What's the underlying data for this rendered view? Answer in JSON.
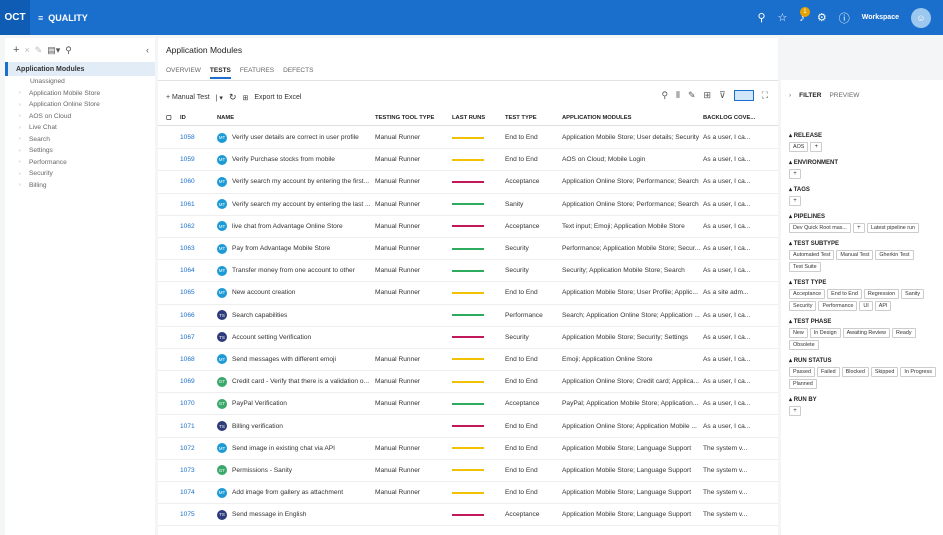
{
  "topbar": {
    "logo": "OCT",
    "menu_icon": "≡",
    "title": "QUALITY",
    "workspace": "Workspace",
    "notification_count": "1"
  },
  "left": {
    "root": "Application Modules",
    "items": [
      {
        "label": "Unassigned",
        "arrow": ""
      },
      {
        "label": "Application Mobile Store",
        "arrow": "›"
      },
      {
        "label": "Application Online Store",
        "arrow": "›"
      },
      {
        "label": "AOS on Cloud",
        "arrow": "›"
      },
      {
        "label": "Live Chat",
        "arrow": "›"
      },
      {
        "label": "Search",
        "arrow": "›"
      },
      {
        "label": "Settings",
        "arrow": "›"
      },
      {
        "label": "Performance",
        "arrow": "›"
      },
      {
        "label": "Security",
        "arrow": "›"
      },
      {
        "label": "Billing",
        "arrow": "›"
      }
    ]
  },
  "main": {
    "title": "Application Modules",
    "tabs": [
      "OVERVIEW",
      "TESTS",
      "FEATURES",
      "DEFECTS"
    ],
    "toolbar": {
      "manual_test": "+ Manual Test",
      "export": "Export to Excel"
    },
    "columns": {
      "id": "ID",
      "name": "NAME",
      "tool": "TESTING TOOL TYPE",
      "last_runs": "LAST RUNS",
      "type": "TEST TYPE",
      "modules": "APPLICATION MODULES",
      "backlog": "BACKLOG COVE..."
    },
    "rows": [
      {
        "id": "1058",
        "icon": "MT",
        "ic_color": "#1b9ad6",
        "name": "Verify user details are correct in user profile",
        "tool": "Manual Runner",
        "lr": "#f2c200",
        "type": "End to End",
        "mod": "Application Mobile Store; User details; Security",
        "back": "As a user, I ca..."
      },
      {
        "id": "1059",
        "icon": "MT",
        "ic_color": "#1b9ad6",
        "name": "Verify Purchase stocks from mobile",
        "tool": "Manual Runner",
        "lr": "#f2c200",
        "type": "End to End",
        "mod": "AOS on Cloud; Mobile Login",
        "back": "As a user, I ca..."
      },
      {
        "id": "1060",
        "icon": "MT",
        "ic_color": "#1b9ad6",
        "name": "Verify search my account by entering the first...",
        "tool": "Manual Runner",
        "lr": "#c2185b",
        "type": "Acceptance",
        "mod": "Application Online Store; Performance; Search",
        "back": "As a user, I ca..."
      },
      {
        "id": "1061",
        "icon": "MT",
        "ic_color": "#1b9ad6",
        "name": "Verify search my account by entering the last ...",
        "tool": "Manual Runner",
        "lr": "#2eaa5e",
        "type": "Sanity",
        "mod": "Application Online Store; Performance; Search",
        "back": "As a user, I ca..."
      },
      {
        "id": "1062",
        "icon": "MT",
        "ic_color": "#1b9ad6",
        "name": "live chat from Advantage Online Store",
        "tool": "Manual Runner",
        "lr": "#c2185b",
        "type": "Acceptance",
        "mod": "Text input; Emoji; Application Mobile Store",
        "back": "As a user, I ca..."
      },
      {
        "id": "1063",
        "icon": "MT",
        "ic_color": "#1b9ad6",
        "name": "Pay from Advantage Mobile Store",
        "tool": "Manual Runner",
        "lr": "#2eaa5e",
        "type": "Security",
        "mod": "Performance; Application Mobile Store; Secur...",
        "back": "As a user, I ca..."
      },
      {
        "id": "1064",
        "icon": "MT",
        "ic_color": "#1b9ad6",
        "name": "Transfer money from one account to other",
        "tool": "Manual Runner",
        "lr": "#2eaa5e",
        "type": "Security",
        "mod": "Security; Application Mobile Store; Search",
        "back": "As a user, I ca..."
      },
      {
        "id": "1065",
        "icon": "MT",
        "ic_color": "#1b9ad6",
        "name": "New account creation",
        "tool": "Manual Runner",
        "lr": "#f2c200",
        "type": "End to End",
        "mod": "Application Mobile Store; User Profile; Applic...",
        "back": "As a site adm..."
      },
      {
        "id": "1066",
        "icon": "TS",
        "ic_color": "#2d3b7a",
        "name": "Search capabilities",
        "tool": "",
        "lr": "#2eaa5e",
        "type": "Performance",
        "mod": "Search; Application Online Store; Application ...",
        "back": "As a user, I ca..."
      },
      {
        "id": "1067",
        "icon": "TS",
        "ic_color": "#2d3b7a",
        "name": "Account setting Verification",
        "tool": "",
        "lr": "#c2185b",
        "type": "Security",
        "mod": "Application Mobile Store; Security; Settings",
        "back": "As a user, I ca..."
      },
      {
        "id": "1068",
        "icon": "MT",
        "ic_color": "#1b9ad6",
        "name": "Send messages with different emoji",
        "tool": "Manual Runner",
        "lr": "#f2c200",
        "type": "End to End",
        "mod": "Emoji; Application Online Store",
        "back": "As a user, I ca..."
      },
      {
        "id": "1069",
        "icon": "GT",
        "ic_color": "#3aa86b",
        "name": "Credit card - Verify that there is a validation o...",
        "tool": "Manual Runner",
        "lr": "#f2c200",
        "type": "End to End",
        "mod": "Application Online Store; Credit card; Applica...",
        "back": "As a user, I ca..."
      },
      {
        "id": "1070",
        "icon": "GT",
        "ic_color": "#3aa86b",
        "name": "PayPal Verification",
        "tool": "Manual Runner",
        "lr": "#2eaa5e",
        "type": "Acceptance",
        "mod": "PayPal; Application Mobile Store; Application...",
        "back": "As a user, I ca..."
      },
      {
        "id": "1071",
        "icon": "TS",
        "ic_color": "#2d3b7a",
        "name": "Billing verification",
        "tool": "",
        "lr": "#c2185b",
        "type": "End to End",
        "mod": "Application Online Store; Application Mobile ...",
        "back": "As a user, I ca..."
      },
      {
        "id": "1072",
        "icon": "MT",
        "ic_color": "#1b9ad6",
        "name": "Send image in existing chat via API",
        "tool": "Manual Runner",
        "lr": "#f2c200",
        "type": "End to End",
        "mod": "Application Mobile Store; Language Support",
        "back": "The system v..."
      },
      {
        "id": "1073",
        "icon": "GT",
        "ic_color": "#3aa86b",
        "name": "Permissions - Sanity",
        "tool": "Manual Runner",
        "lr": "#f2c200",
        "type": "End to End",
        "mod": "Application Mobile Store; Language Support",
        "back": "The system v..."
      },
      {
        "id": "1074",
        "icon": "MT",
        "ic_color": "#1b9ad6",
        "name": "Add image from gallery as attachment",
        "tool": "Manual Runner",
        "lr": "#f2c200",
        "type": "End to End",
        "mod": "Application Mobile Store; Language Support",
        "back": "The system v..."
      },
      {
        "id": "1075",
        "icon": "TS",
        "ic_color": "#2d3b7a",
        "name": "Send message in English",
        "tool": "",
        "lr": "#c2185b",
        "type": "Acceptance",
        "mod": "Application Mobile Store; Language Support",
        "back": "The system v..."
      }
    ]
  },
  "right": {
    "tabs": [
      "FILTER",
      "PREVIEW"
    ],
    "groups": [
      {
        "title": "RELEASE",
        "chips": [
          "AOS",
          "+"
        ]
      },
      {
        "title": "ENVIRONMENT",
        "chips": [
          "+"
        ]
      },
      {
        "title": "TAGS",
        "chips": [
          "+"
        ]
      },
      {
        "title": "PIPELINES",
        "chips": [
          "Dev Quick Root mas...",
          "+",
          "Latest pipeline run"
        ]
      },
      {
        "title": "TEST SUBTYPE",
        "chips": [
          "Automated Test",
          "Manual Test",
          "Gherkin Test",
          "Test Suite"
        ]
      },
      {
        "title": "TEST TYPE",
        "chips": [
          "Acceptance",
          "End to End",
          "Regression",
          "Sanity",
          "Security",
          "Performance",
          "UI",
          "API"
        ]
      },
      {
        "title": "TEST PHASE",
        "chips": [
          "New",
          "In Design",
          "Awaiting Review",
          "Ready",
          "Obsolete"
        ]
      },
      {
        "title": "RUN STATUS",
        "chips": [
          "Passed",
          "Failed",
          "Blocked",
          "Skipped",
          "In Progress",
          "Planned"
        ]
      },
      {
        "title": "RUN BY",
        "chips": [
          "+"
        ]
      }
    ]
  }
}
